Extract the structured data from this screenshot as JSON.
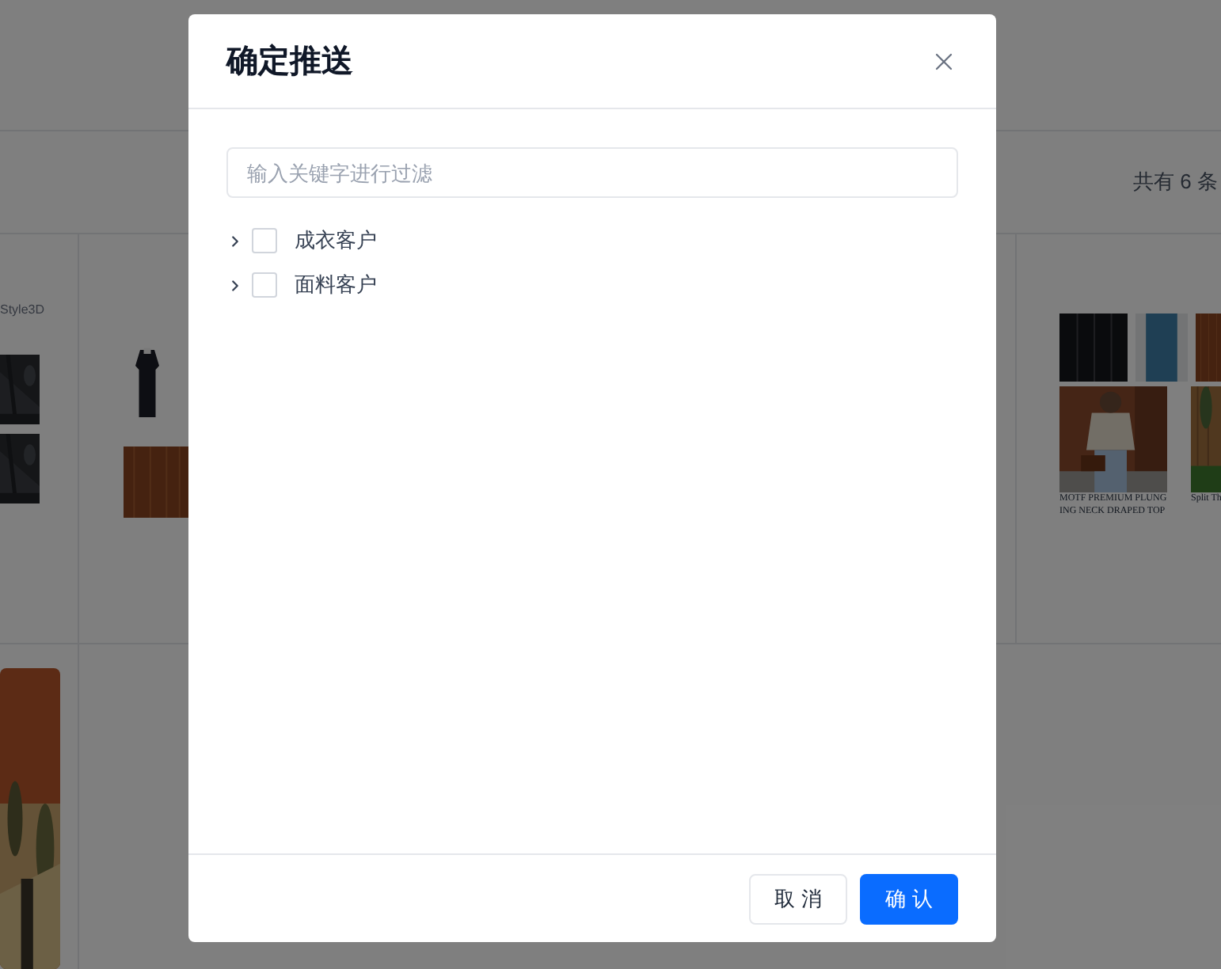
{
  "background": {
    "count_text": "共有 6 条",
    "brand_text": "Style3D",
    "captions": [
      "MOTF PREMIUM PLUNGING NECK DRAPED TOP",
      "Split Th"
    ]
  },
  "dialog": {
    "title": "确定推送",
    "filter": {
      "placeholder": "输入关键字进行过滤"
    },
    "tree": [
      {
        "label": "成衣客户",
        "expanded": false,
        "checked": false
      },
      {
        "label": "面料客户",
        "expanded": false,
        "checked": false
      }
    ],
    "buttons": [
      {
        "label": "取 消",
        "kind": "secondary"
      },
      {
        "label": "确 认",
        "kind": "primary"
      }
    ]
  }
}
